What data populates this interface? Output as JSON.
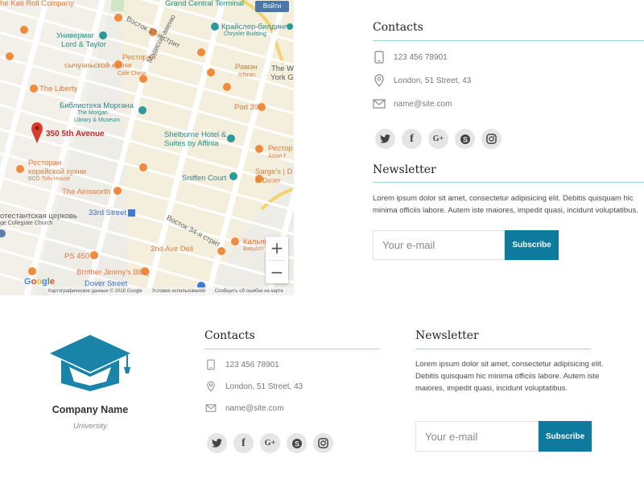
{
  "map": {
    "login_label": "Войти",
    "labels": [
      {
        "text": "he Kati Roll Company",
        "cls": "orange"
      },
      {
        "text": "Grand Central Terminal",
        "cls": "teal"
      },
      {
        "text": "Универмаг",
        "cls": "teal"
      },
      {
        "text": "Lord & Taylor",
        "cls": "teal"
      },
      {
        "text": "Крайслер-билдинг",
        "cls": "teal"
      },
      {
        "text": "Chrysler Building",
        "cls": "teal small"
      },
      {
        "text": "Ресторан",
        "cls": "orange"
      },
      {
        "text": "сычуаньской кухни",
        "cls": "orange"
      },
      {
        "text": "Cafe China",
        "cls": "orange small"
      },
      {
        "text": "Рамэн",
        "cls": "orange"
      },
      {
        "text": "Ichiran",
        "cls": "orange small"
      },
      {
        "text": "The W",
        "cls": "dark"
      },
      {
        "text": "York Gr",
        "cls": "dark"
      },
      {
        "text": "The Liberty",
        "cls": "orange"
      },
      {
        "text": "Библиотека Моргана",
        "cls": "teal"
      },
      {
        "text": "The Morgan",
        "cls": "teal small"
      },
      {
        "text": "Library & Museum",
        "cls": "teal small"
      },
      {
        "text": "Pod 39",
        "cls": "orange"
      },
      {
        "text": "350 5th Avenue",
        "cls": "red"
      },
      {
        "text": "Shelburne Hotel &",
        "cls": "teal"
      },
      {
        "text": "Suites by Affinia",
        "cls": "teal"
      },
      {
        "text": "Рестор",
        "cls": "orange"
      },
      {
        "text": "Asian f",
        "cls": "orange small"
      },
      {
        "text": "Ресторан",
        "cls": "orange"
      },
      {
        "text": "корейской кухни",
        "cls": "orange"
      },
      {
        "text": "BCD Tofu House",
        "cls": "orange small"
      },
      {
        "text": "Sniffen Court",
        "cls": "teal"
      },
      {
        "text": "Sarge's | D",
        "cls": "orange"
      },
      {
        "text": "& Diner",
        "cls": "orange"
      },
      {
        "text": "The Ainsworth",
        "cls": "orange"
      },
      {
        "text": "33rd Street",
        "cls": "blue"
      },
      {
        "text": "отестантская церковь",
        "cls": "dark"
      },
      {
        "text": "ge Collegiate Church",
        "cls": "dark small"
      },
      {
        "text": "2nd Ave Deli",
        "cls": "orange"
      },
      {
        "text": "Кальян",
        "cls": "orange"
      },
      {
        "text": "Babylon",
        "cls": "orange small"
      },
      {
        "text": "PS 450",
        "cls": "orange"
      },
      {
        "text": "Brother Jimmy's BBQ",
        "cls": "orange"
      },
      {
        "text": "Dover Street",
        "cls": "blue"
      },
      {
        "text": "Мэдисон-авеню",
        "cls": "street"
      },
      {
        "text": "Восток 34-я стрит",
        "cls": "street"
      },
      {
        "text": "Восток 37-я стрит",
        "cls": "street"
      }
    ],
    "footer": [
      "Картографические данные © 2018 Google",
      "Условия использования",
      "Сообщить об ошибке на карте"
    ],
    "zoom_in": "+",
    "zoom_out": "−"
  },
  "top_contacts": {
    "title": "Contacts",
    "items": [
      {
        "icon": "phone-icon",
        "text": "123 456 78901"
      },
      {
        "icon": "location-pin-icon",
        "text": "London, 51 Street, 43"
      },
      {
        "icon": "envelope-icon",
        "text": "name@site.com"
      }
    ]
  },
  "social": [
    {
      "name": "twitter-icon",
      "glyph": "🐦"
    },
    {
      "name": "facebook-icon",
      "glyph": "f"
    },
    {
      "name": "google-plus-icon",
      "glyph": "G+"
    },
    {
      "name": "skype-icon",
      "glyph": "S"
    },
    {
      "name": "instagram-icon",
      "glyph": "◎"
    }
  ],
  "top_newsletter": {
    "title": "Newsletter",
    "text": "Lorem ipsum dolor sit amet, consectetur adipisicing elit. Debitis quisquam hic minima officiis labore. Autem iste maiores, impedit quasi, incidunt voluptatibus.",
    "placeholder": "Your e-mail",
    "button": "Subscribe"
  },
  "brand": {
    "name": "Company Name",
    "subtitle": "University"
  },
  "bottom_contacts": {
    "title": "Contacts",
    "items": [
      {
        "icon": "phone-icon",
        "text": "123 456 78901"
      },
      {
        "icon": "location-pin-icon",
        "text": "London, 51 Street, 43"
      },
      {
        "icon": "envelope-icon",
        "text": "name@site.com"
      }
    ]
  },
  "bottom_newsletter": {
    "title": "Newsletter",
    "text": "Lorem ipsum dolor sit amet, consectetur adipisicing elit. Debitis quisquam hic minima officiis labore. Autem iste maiores, impedit quasi, incidunt voluptatibus.",
    "placeholder": "Your e-mail",
    "button": "Subscribe"
  },
  "colors": {
    "accent": "#0e7a9e",
    "logo": "#1a83a8",
    "rule": "#a9d2e3",
    "social_bg": "#e5e5e5"
  }
}
